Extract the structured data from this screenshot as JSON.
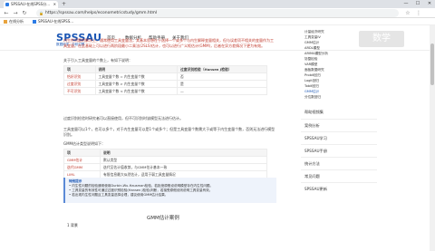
{
  "browser": {
    "tab_title": "SPSSAU-在线SPSS分...",
    "new_tab": "+",
    "url": "https://spssau.com/helps/econometricstudy/gmm.html",
    "window_controls": [
      "—",
      "☐",
      "✕"
    ],
    "bookmarks": [
      "在线分析",
      "SPSSAU-在线SPSS..."
    ]
  },
  "site": {
    "logo": "SPSSAU",
    "logo_sub": "数据科学 · 分析引擎",
    "nav": [
      "首页",
      "数据分析",
      "帮助手册",
      "关于我们"
    ],
    "search_watermark": "数学"
  },
  "article": {
    "intro": "内生性问题的解决上，通常使用工具变量法，其基本思想在于选择一个或多个与内生解释变量相关，但与误差项不相关的变量作为工具变量。在此基础上可以进行两阶段最小二乘法(2SLS)估计，也可以进行广义矩估计(GMM)，后者在异方差情况下更为有效。",
    "intro2": "关于引入工具变量的个数上，有如下说明：",
    "table1": {
      "headers": [
        "项",
        "说明",
        "过度识别检验（Hansen J检验）"
      ],
      "rows": [
        [
          "恰好识别",
          "工具变量个数 = 内生变量个数",
          "否"
        ],
        [
          "过度识别",
          "工具变量个数 > 内生变量个数",
          "是"
        ],
        [
          "不可识别",
          "工具变量个数 < 内生变量个数",
          "—"
        ]
      ]
    },
    "para2": "过度识别检验时研究者可以直接使用，但不可识别时该模型无法进行估计。",
    "para3": "工具变量可以1个，也可以多个，对于内生变量可以是1个或多个；但是工具变量个数需大于或等于内生变量个数，否则无法进行模型识别。",
    "para4": "GMM估计类型说明如下：",
    "table2": {
      "headers": [
        "项",
        "说明"
      ],
      "rows": [
        [
          "GMM估计",
          "默认类型"
        ],
        [
          "迭代GMM",
          "迭代至估计值收敛，与GMM估计基本一致"
        ],
        [
          "LIML",
          "有限信息最大似然估计，适用于弱工具变量情况"
        ]
      ]
    },
    "note_title": "特别提示",
    "note_lines": [
      "• 内生性问题的检验通常使用Durbin-Wu-Hausman检验，若拒绝原假设说明模型存在内生性问题。",
      "• 工具变量的有效性可通过过度识别检验(Hansen J检验)判断，若接受原假设则说明工具变量有效。",
      "• 若出现内生性问题且工具变量选择合理，建议使用GMM估计结果。"
    ],
    "section_title": "GMM估计案例",
    "subhead": "1  背景"
  },
  "sidebar": {
    "items": [
      "计量经济研究",
      "工具变量IV",
      "GMM估计",
      "ARDL模型",
      "ARIMA模型分析",
      "协整检验",
      "VAR模型",
      "面板数据研究",
      "Probit回归",
      "Logit回归",
      "Tobit回归",
      "GMM估计",
      "分位数回归"
    ],
    "active_index": 11,
    "menus": [
      "帮助视频集",
      "案例分析",
      "SPSSAU学习",
      "SPSSAU手册",
      "统计方法",
      "常见问题",
      "SPSSAU更新"
    ]
  }
}
